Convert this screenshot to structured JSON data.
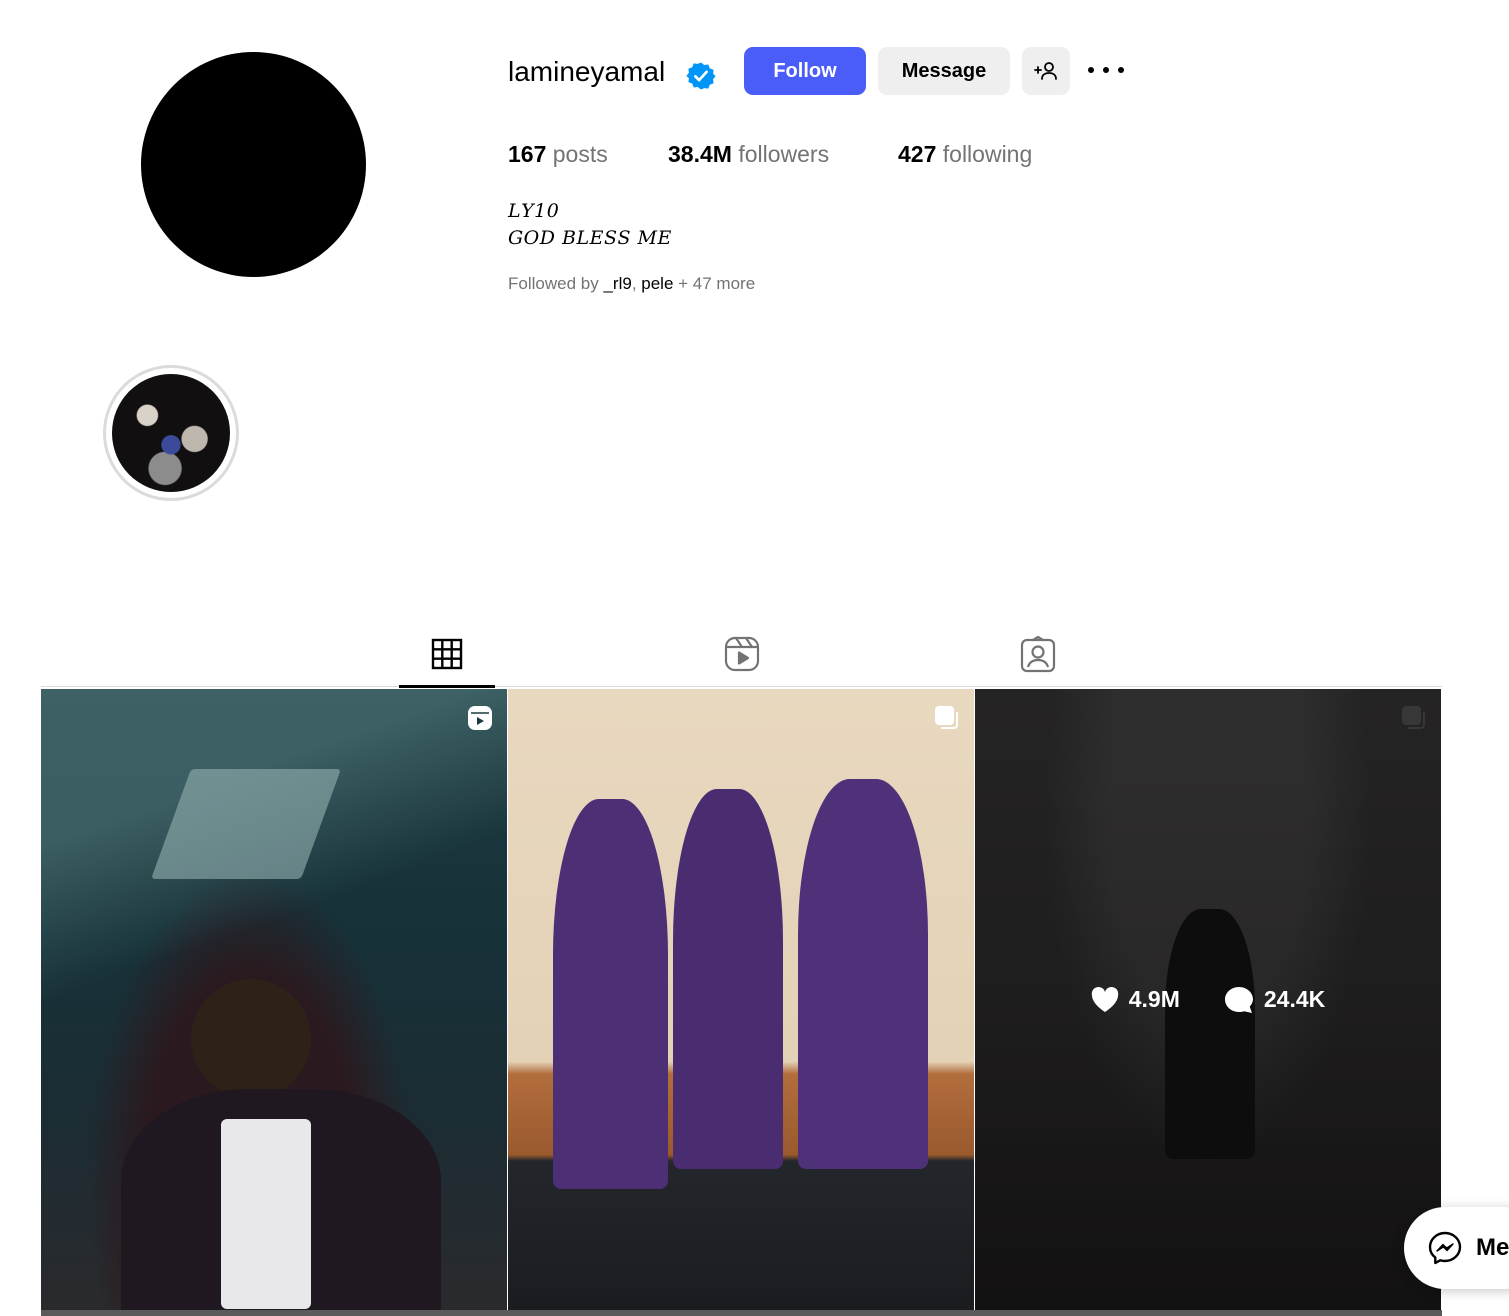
{
  "profile": {
    "username": "lamineyamal",
    "verified": true,
    "follow_label": "Follow",
    "message_label": "Message",
    "posts_count": "167",
    "posts_label": "posts",
    "followers_count": "38.4M",
    "followers_label": "followers",
    "following_count": "427",
    "following_label": "following",
    "bio_line1": "𝐿𝑌10",
    "bio_line2": "𝐺𝑂𝐷 𝐵𝐿𝐸𝑆𝑆 𝑀𝐸",
    "followed_by_prefix": "Followed by",
    "followed_by_users": [
      "_rl9",
      "pele"
    ],
    "followed_by_more": "+ 47 more"
  },
  "tabs": [
    {
      "icon": "grid-icon",
      "active": true
    },
    {
      "icon": "reels-icon",
      "active": false
    },
    {
      "icon": "tagged-icon",
      "active": false
    }
  ],
  "posts": [
    {
      "type": "reel",
      "icon": "reel-icon"
    },
    {
      "type": "carousel",
      "icon": "carousel-icon"
    },
    {
      "type": "carousel",
      "icon": "carousel-icon",
      "hovered": true,
      "likes": "4.9M",
      "comments": "24.4K"
    }
  ],
  "messenger": {
    "label": "Me"
  },
  "colors": {
    "accent": "#4a5df9",
    "verified": "#0095f6",
    "secondary_text": "#737373",
    "button_bg": "#efefef"
  }
}
